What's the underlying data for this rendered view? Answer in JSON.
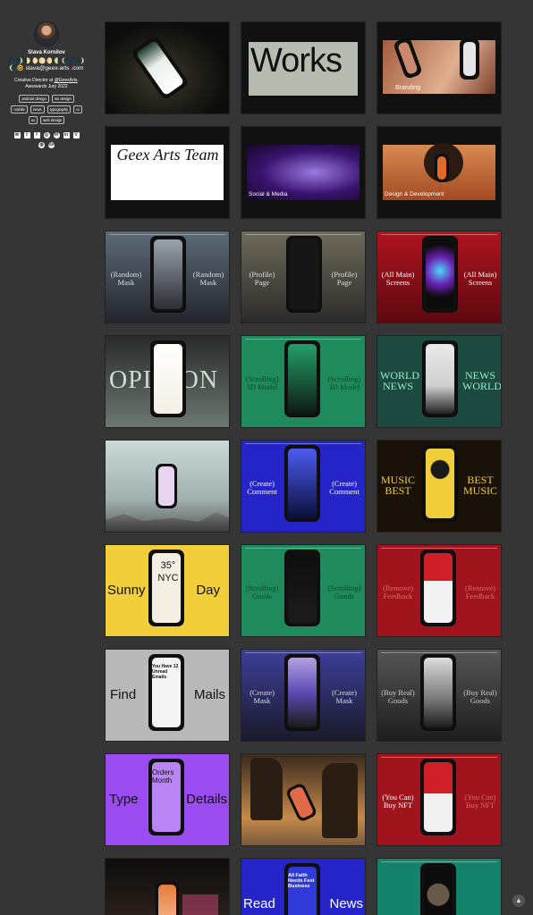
{
  "profile": {
    "name": "Slava Kornilov",
    "emoji_line": "🌑🌒🌓🌔🌕🌖🌗🌘🌑🌒",
    "email": "🌘🤓 slava@geex-arts .com",
    "bio_role": "Creative Director at",
    "bio_company": "@GeexArts",
    "bio_awards": "Awwwards Jury 2022",
    "tags": [
      "android design",
      "ios design",
      "mobile",
      "news",
      "typography",
      "ui",
      "ux",
      "web design"
    ],
    "socials": [
      {
        "icon": "email-icon",
        "glyph": "✉"
      },
      {
        "icon": "twitter-icon",
        "glyph": "t"
      },
      {
        "icon": "facebook-icon",
        "glyph": "f"
      },
      {
        "icon": "instagram-icon",
        "glyph": "◎"
      },
      {
        "icon": "medium-icon",
        "glyph": "M"
      },
      {
        "icon": "linkedin-icon",
        "glyph": "in"
      },
      {
        "icon": "vimeo-icon",
        "glyph": "V"
      },
      {
        "icon": "dribbble-icon",
        "glyph": "◍"
      },
      {
        "icon": "behance-icon",
        "glyph": "Bē"
      }
    ]
  },
  "projects": [
    {
      "left": "",
      "right": "",
      "big": ""
    },
    {
      "left": "",
      "right": "",
      "big": "Works"
    },
    {
      "left": "",
      "right": "",
      "big": "Branding"
    },
    {
      "left": "",
      "right": "",
      "big": "Geex Arts Team"
    },
    {
      "left": "",
      "right": "",
      "big": "Social & Media"
    },
    {
      "left": "",
      "right": "",
      "big": "Design & Development"
    },
    {
      "left": "(Random) Mask",
      "right": "(Random) Mask",
      "big": ""
    },
    {
      "left": "(Profile) Page",
      "right": "(Profile) Page",
      "big": ""
    },
    {
      "left": "(All Main) Screens",
      "right": "(All Main) Screens",
      "big": ""
    },
    {
      "left": "",
      "right": "",
      "big": "OPINION"
    },
    {
      "left": "(Scrolling) 3D Model",
      "right": "(Scrolling) 3D Model",
      "big": ""
    },
    {
      "left": "WORLD NEWS",
      "right": "NEWS WORLD",
      "big": ""
    },
    {
      "left": "",
      "right": "",
      "big": ""
    },
    {
      "left": "(Create) Comment",
      "right": "(Create) Comment",
      "big": ""
    },
    {
      "left": "MUSIC BEST",
      "right": "BEST MUSIC",
      "big": ""
    },
    {
      "left": "Sunny",
      "right": "Day",
      "big": "35° NYC"
    },
    {
      "left": "(Scrolling) Goods",
      "right": "(Scrolling) Goods",
      "big": ""
    },
    {
      "left": "(Remove) Feedback",
      "right": "(Remove) Feedback",
      "big": ""
    },
    {
      "left": "Find",
      "right": "Mails",
      "big": "You Have 12 Unread Emails"
    },
    {
      "left": "(Create) Mask",
      "right": "(Create) Mask",
      "big": ""
    },
    {
      "left": "(Buy Real) Goods",
      "right": "(Buy Real) Goods",
      "big": ""
    },
    {
      "left": "Type",
      "right": "Details",
      "big": "Orders Month"
    },
    {
      "left": "",
      "right": "",
      "big": ""
    },
    {
      "left": "(You Can) Buy NFT",
      "right": "(You Can) Buy NFT",
      "big": ""
    },
    {
      "left": "",
      "right": "",
      "big": ""
    },
    {
      "left": "Read",
      "right": "News",
      "big": "All Faith Needs Feet Business"
    },
    {
      "left": "",
      "right": "",
      "big": ""
    }
  ],
  "colors": {
    "background": "#353535",
    "card_green": "#1f8a5c",
    "card_red": "#a0141e",
    "card_blue": "#2424c8",
    "card_yellow": "#f2cf3a",
    "card_purple": "#9a4cf0"
  },
  "scroll_top_icon": "arrow-up-icon"
}
